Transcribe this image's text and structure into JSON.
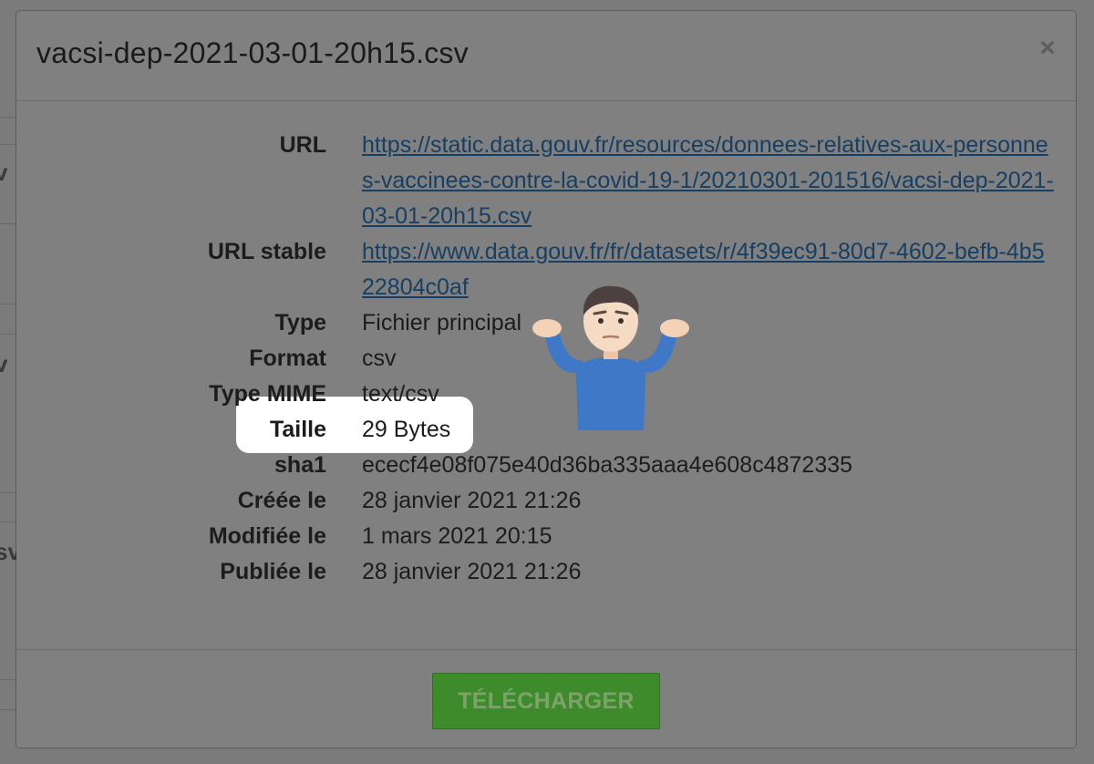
{
  "modal": {
    "title": "vacsi-dep-2021-03-01-20h15.csv",
    "close_label": "×",
    "fields": [
      {
        "label": "URL",
        "value": "https://static.data.gouv.fr/resources/donnees-relatives-aux-personnes-vaccinees-contre-la-covid-19-1/20210301-201516/vacsi-dep-2021-03-01-20h15.csv",
        "is_link": true
      },
      {
        "label": "URL stable",
        "value": "https://www.data.gouv.fr/fr/datasets/r/4f39ec91-80d7-4602-befb-4b522804c0af",
        "is_link": true
      },
      {
        "label": "Type",
        "value": "Fichier principal",
        "is_link": false
      },
      {
        "label": "Format",
        "value": "csv",
        "is_link": false
      },
      {
        "label": "Type MIME",
        "value": "text/csv",
        "is_link": false
      },
      {
        "label": "Taille",
        "value": "29 Bytes",
        "is_link": false
      },
      {
        "label": "sha1",
        "value": "ececf4e08f075e40d36ba335aaa4e608c4872335",
        "is_link": false
      },
      {
        "label": "Créée le",
        "value": "28 janvier 2021 21:26",
        "is_link": false
      },
      {
        "label": "Modifiée le",
        "value": "1 mars 2021 20:15",
        "is_link": false
      },
      {
        "label": "Publiée le",
        "value": "28 janvier 2021 21:26",
        "is_link": false
      }
    ],
    "download_label": "TÉLÉCHARGER"
  },
  "overlay": {
    "emoji_name": "man-shrugging-icon"
  },
  "colors": {
    "link": "#163f63",
    "download_button": "#3e8b2c",
    "highlight": "#ffffff"
  }
}
